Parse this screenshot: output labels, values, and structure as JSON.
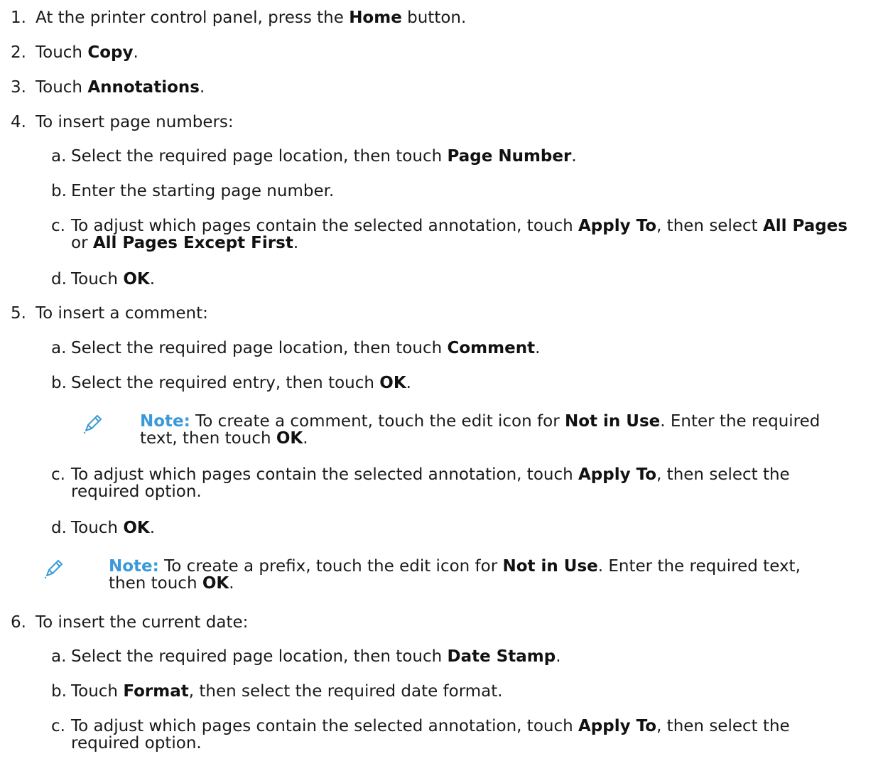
{
  "steps": {
    "s1": {
      "num": "1.",
      "pre": "At the printer control panel, press the ",
      "bold": "Home",
      "post": " button."
    },
    "s2": {
      "num": "2.",
      "pre": "Touch ",
      "bold": "Copy",
      "post": "."
    },
    "s3": {
      "num": "3.",
      "pre": "Touch ",
      "bold": "Annotations",
      "post": "."
    },
    "s4": {
      "num": "4.",
      "text": "To insert page numbers:",
      "a": {
        "letter": "a.",
        "pre": "Select the required page location, then touch ",
        "bold": "Page Number",
        "post": "."
      },
      "b": {
        "letter": "b.",
        "text": "Enter the starting page number."
      },
      "c": {
        "letter": "c.",
        "pre": "To adjust which pages contain the selected annotation, touch ",
        "bold1": "Apply To",
        "mid": ", then select ",
        "bold2": "All Pages",
        "line2_pre": "or ",
        "bold3": "All Pages Except First",
        "line2_post": "."
      },
      "d": {
        "letter": "d.",
        "pre": "Touch ",
        "bold": "OK",
        "post": "."
      }
    },
    "s5": {
      "num": "5.",
      "text": "To insert a comment:",
      "a": {
        "letter": "a.",
        "pre": "Select the required page location, then touch ",
        "bold": "Comment",
        "post": "."
      },
      "b": {
        "letter": "b.",
        "pre": "Select the required entry, then touch ",
        "bold": "OK",
        "post": "."
      },
      "note1": {
        "label": "Note:",
        "pre": " To create a comment, touch the edit icon for ",
        "bold1": "Not in Use",
        "mid": ". Enter the required",
        "line2_pre": "text, then touch ",
        "bold2": "OK",
        "line2_post": "."
      },
      "c": {
        "letter": "c.",
        "pre": "To adjust which pages contain the selected annotation, touch ",
        "bold": "Apply To",
        "post": ", then select the",
        "line2": "required option."
      },
      "d": {
        "letter": "d.",
        "pre": "Touch ",
        "bold": "OK",
        "post": "."
      },
      "note2": {
        "label": "Note:",
        "pre": " To create a prefix, touch the edit icon for ",
        "bold1": "Not in Use",
        "mid": ". Enter the required text,",
        "line2_pre": "then touch ",
        "bold2": "OK",
        "line2_post": "."
      }
    },
    "s6": {
      "num": "6.",
      "text": "To insert the current date:",
      "a": {
        "letter": "a.",
        "pre": "Select the required page location, then touch ",
        "bold": "Date Stamp",
        "post": "."
      },
      "b": {
        "letter": "b.",
        "pre": "Touch ",
        "bold": "Format",
        "post": ", then select the required date format."
      },
      "c": {
        "letter": "c.",
        "pre": "To adjust which pages contain the selected annotation, touch ",
        "bold": "Apply To",
        "post": ", then select the",
        "line2": "required option."
      }
    }
  },
  "colors": {
    "note_label": "#3a9ad9",
    "pencil_icon": "#3a9ad9",
    "text": "#1a1a1a"
  },
  "icons": [
    "pencil-icon"
  ]
}
